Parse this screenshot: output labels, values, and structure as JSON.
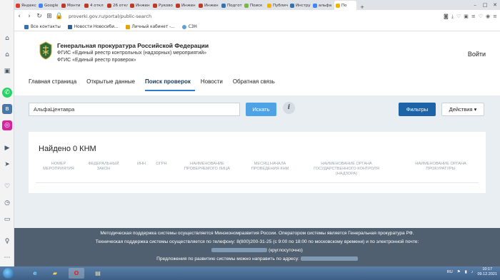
{
  "browser": {
    "tabs": [
      {
        "label": "Яндекс",
        "color": "#e5392a"
      },
      {
        "label": "Google",
        "color": "#4285f4"
      },
      {
        "label": "Монти",
        "color": "#c0392b"
      },
      {
        "label": "4 откл",
        "color": "#c0392b"
      },
      {
        "label": "26 откл",
        "color": "#c0392b"
      },
      {
        "label": "Инжен",
        "color": "#c0392b"
      },
      {
        "label": "Руково",
        "color": "#c0392b"
      },
      {
        "label": "Инжен",
        "color": "#c0392b"
      },
      {
        "label": "Инжен",
        "color": "#c0392b"
      },
      {
        "label": "Подгот",
        "color": "#3a6fb0"
      },
      {
        "label": "Поиск",
        "color": "#7ab648"
      },
      {
        "label": "Публич",
        "color": "#f0b400"
      },
      {
        "label": "Инстру",
        "color": "#3a6fb0"
      },
      {
        "label": "альфа",
        "color": "#4285f4"
      },
      {
        "label": "По",
        "color": "#f0b400"
      }
    ],
    "url": "proverki.gov.ru/portal/public-search",
    "bookmarks": [
      {
        "label": "Все контакты",
        "color": "#3a6fb0"
      },
      {
        "label": "Новости Новосиби...",
        "color": "#2a5d9a"
      },
      {
        "label": "Личный кабинет -...",
        "color": "#e5a400"
      },
      {
        "label": "СЗН",
        "color": "#5aa0d8"
      }
    ]
  },
  "header": {
    "title": "Генеральная прокуратура Российской Федерации",
    "subtitle1": "ФГИС «Единый реестр контрольных (надзорных) мероприятий»",
    "subtitle2": "ФГИС «Единый реестр проверок»",
    "login": "Войти"
  },
  "menu": [
    "Главная страница",
    "Открытые данные",
    "Поиск проверок",
    "Новости",
    "Обратная связь"
  ],
  "search": {
    "value": "АльфаЦентавра",
    "button": "Искать",
    "info": "i",
    "filters": "Фильтры",
    "actions": "Действия ▾"
  },
  "results": {
    "found": "Найдено 0 КНМ",
    "columns": [
      "НОМЕР МЕРОПРИЯТИЯ",
      "ФЕДЕРАЛЬНЫЙ ЗАКОН",
      "ИНН",
      "ОГРН",
      "НАИМЕНОВАНИЕ ПРОВЕРЯЕМОГО ЛИЦА",
      "МЕСЯЦ НАЧАЛА ПРОВЕДЕНИЯ КНМ",
      "НАИМЕНОВАНИЕ ОРГАНА ГОСУДАРСТВЕННОГО КОНТРОЛЯ (НАДЗОРА)",
      "НАИМЕНОВАНИЕ ОРГАНА ПРОКУРАТУРЫ"
    ]
  },
  "footer": {
    "line1": "Методическая поддержка системы осуществляется Минэкономразвития России. Оператором системы является Генеральная прокуратура РФ.",
    "line2": "Техническая поддержка системы осуществляется по телефону: 8(800)200-31-25 (с 9:00 по 18:00 по московскому времени) и по электронной почте:",
    "line3": "(круглосуточно)",
    "line4": "Предложения по развитию системы можно направить по адресу:"
  },
  "taskbar": {
    "lang": "RU",
    "time": "10:17",
    "date": "09.12.2021"
  }
}
